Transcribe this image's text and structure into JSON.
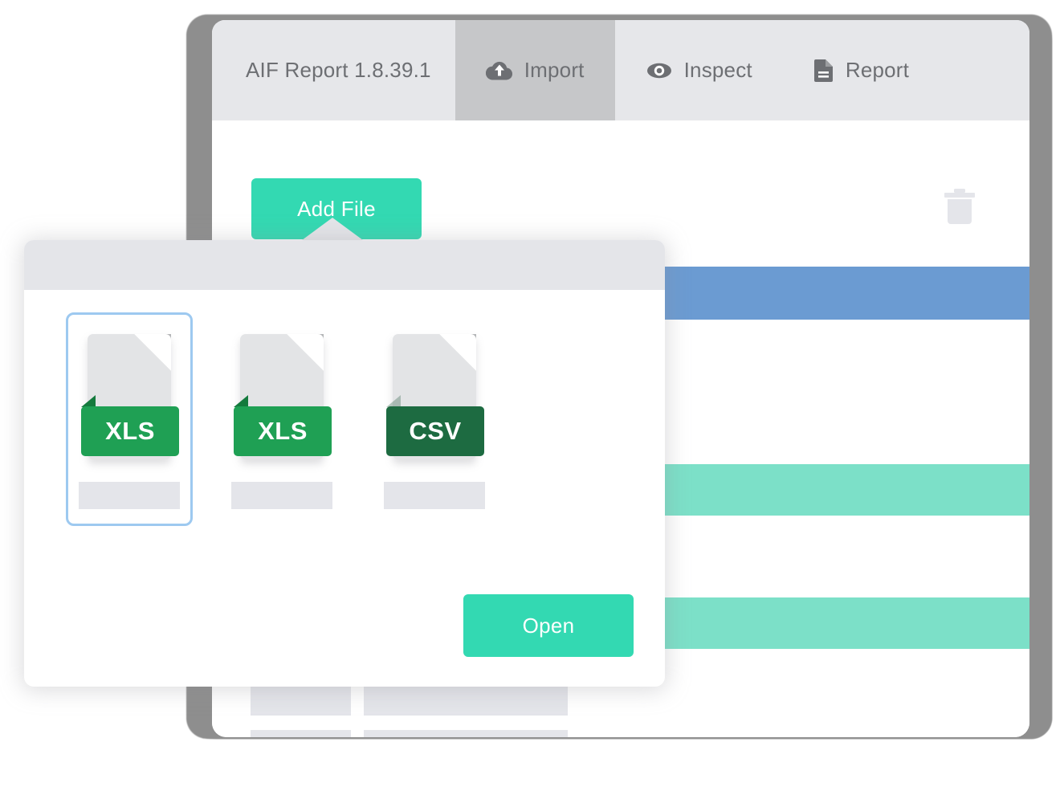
{
  "app_window": {
    "tabs": [
      {
        "label": "AIF Report 1.8.39.1",
        "icon": "",
        "active": false
      },
      {
        "label": "Import",
        "icon": "cloud-upload-icon",
        "active": true
      },
      {
        "label": "Inspect",
        "icon": "eye-icon",
        "active": false
      },
      {
        "label": "Report",
        "icon": "document-icon",
        "active": false
      }
    ],
    "toolbar": {
      "add_file_label": "Add File",
      "delete_icon": "trash-icon"
    },
    "table": {
      "header_color": "#6b9bd2",
      "highlight_color": "#7ce0c8",
      "cell_color": "#e4e5ea",
      "rows": [
        {
          "type": "header"
        },
        {
          "type": "cells"
        },
        {
          "type": "spacer"
        },
        {
          "type": "highlight"
        },
        {
          "type": "cells"
        },
        {
          "type": "spacer"
        },
        {
          "type": "highlight"
        },
        {
          "type": "cells"
        },
        {
          "type": "cells"
        }
      ]
    }
  },
  "dialog": {
    "title": "",
    "files": [
      {
        "name": "",
        "extension": "XLS",
        "ribbon_color": "#1fa054",
        "selected": true
      },
      {
        "name": "",
        "extension": "XLS",
        "ribbon_color": "#1fa054",
        "selected": false
      },
      {
        "name": "",
        "extension": "CSV",
        "ribbon_color": "#1d6b41",
        "selected": false
      }
    ],
    "open_label": "Open"
  },
  "colors": {
    "accent_teal": "#33d9b2",
    "tab_bar": "#e6e7ea",
    "tab_active": "#c6c7c9",
    "selection_blue": "#9dc9f0",
    "table_header_blue": "#6b9bd2",
    "table_highlight": "#7ce0c8",
    "placeholder_gray": "#e4e5ea",
    "text_gray": "#6d6f73"
  }
}
